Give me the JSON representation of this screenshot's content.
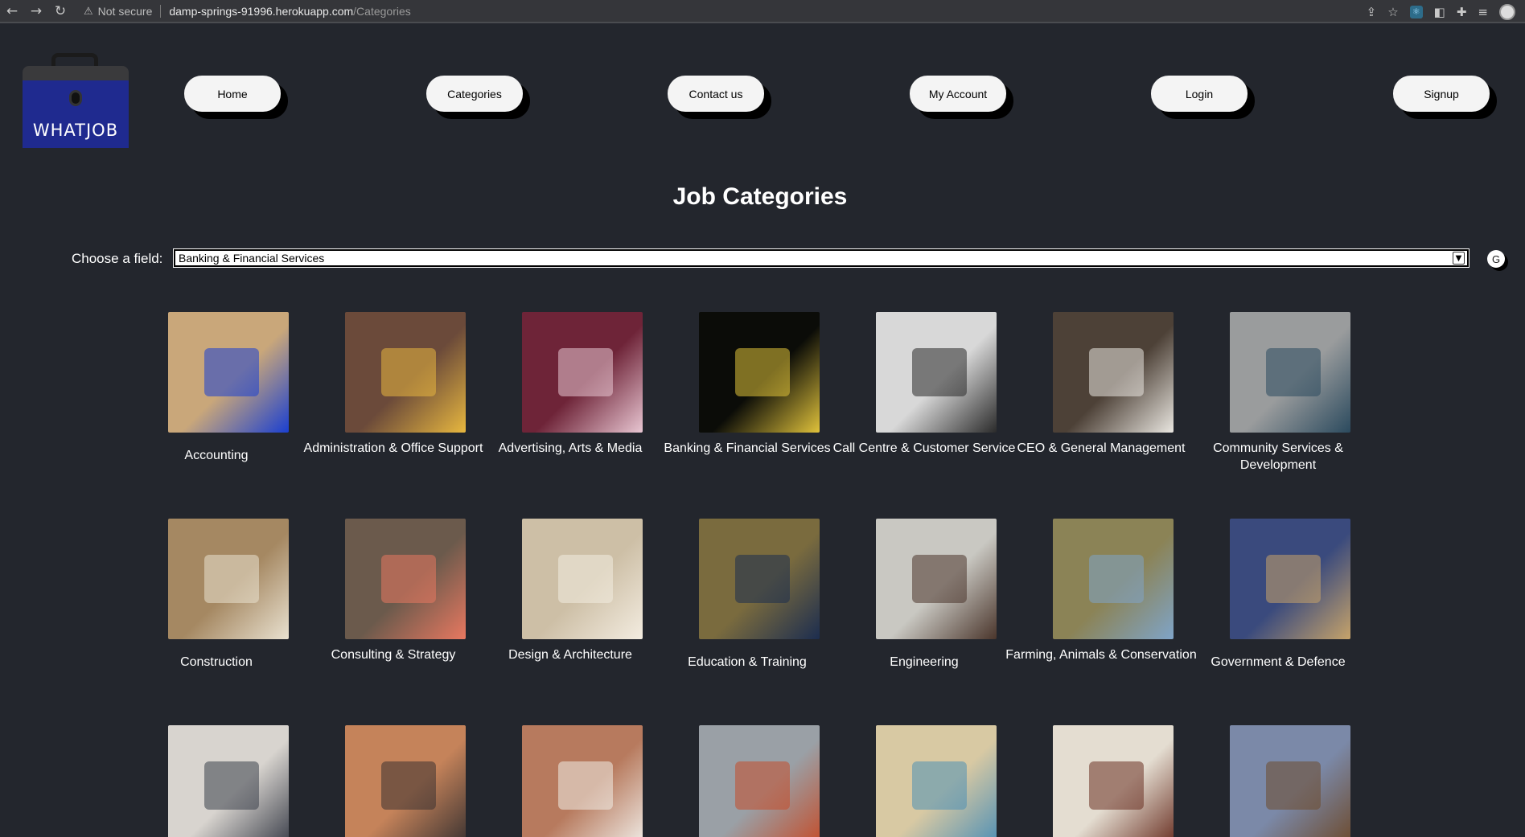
{
  "browser": {
    "security_text": "Not secure",
    "url_host": "damp-springs-91996.herokuapp.com",
    "url_path": "/Categories"
  },
  "logo": {
    "text": "WHATJOB"
  },
  "nav": [
    {
      "label": "Home"
    },
    {
      "label": "Categories"
    },
    {
      "label": "Contact us"
    },
    {
      "label": "My Account"
    },
    {
      "label": "Login"
    },
    {
      "label": "Signup"
    }
  ],
  "page": {
    "title": "Job Categories",
    "choose_label": "Choose a field:",
    "selected_field": "Banking & Financial Services",
    "g_button": "G"
  },
  "categories": [
    {
      "label": "Accounting",
      "color": "#c9a77a",
      "accent": "#1a3fd1"
    },
    {
      "label": "Administration & Office Support",
      "color": "#6b4a3a",
      "accent": "#e7b73f"
    },
    {
      "label": "Advertising, Arts & Media",
      "color": "#6e2438",
      "accent": "#e8c6d2"
    },
    {
      "label": "Banking & Financial Services",
      "color": "#0b0c08",
      "accent": "#e0c23b"
    },
    {
      "label": "Call Centre & Customer Service",
      "color": "#d8d8d8",
      "accent": "#2a2a2a"
    },
    {
      "label": "CEO & General Management",
      "color": "#4d4137",
      "accent": "#e9e6e0"
    },
    {
      "label": "Community Services & Development",
      "color": "#9a9c9d",
      "accent": "#2b4a5e"
    },
    {
      "label": "Construction",
      "color": "#a58862",
      "accent": "#e9e1d0"
    },
    {
      "label": "Consulting & Strategy",
      "color": "#6b5a4c",
      "accent": "#e87860"
    },
    {
      "label": "Design & Architecture",
      "color": "#cdbfa6",
      "accent": "#f3ece0"
    },
    {
      "label": "Education & Training",
      "color": "#7a6b3e",
      "accent": "#1c2d4f"
    },
    {
      "label": "Engineering",
      "color": "#c9c8c2",
      "accent": "#4a352b"
    },
    {
      "label": "Farming, Animals & Conservation",
      "color": "#8b8356",
      "accent": "#7fa4c8"
    },
    {
      "label": "Government & Defence",
      "color": "#3a4a7d",
      "accent": "#c6a36a"
    },
    {
      "label": "",
      "color": "#d8d4cf",
      "accent": "#3b3f4a"
    },
    {
      "label": "",
      "color": "#c5835a",
      "accent": "#3a3231"
    },
    {
      "label": "",
      "color": "#b77a5e",
      "accent": "#f0ece6"
    },
    {
      "label": "",
      "color": "#9aa0a6",
      "accent": "#c44d2a"
    },
    {
      "label": "",
      "color": "#d8c9a3",
      "accent": "#4e8fb5"
    },
    {
      "label": "",
      "color": "#e4ddd1",
      "accent": "#6a3023"
    },
    {
      "label": "",
      "color": "#7b89a8",
      "accent": "#6d4a2c"
    }
  ]
}
